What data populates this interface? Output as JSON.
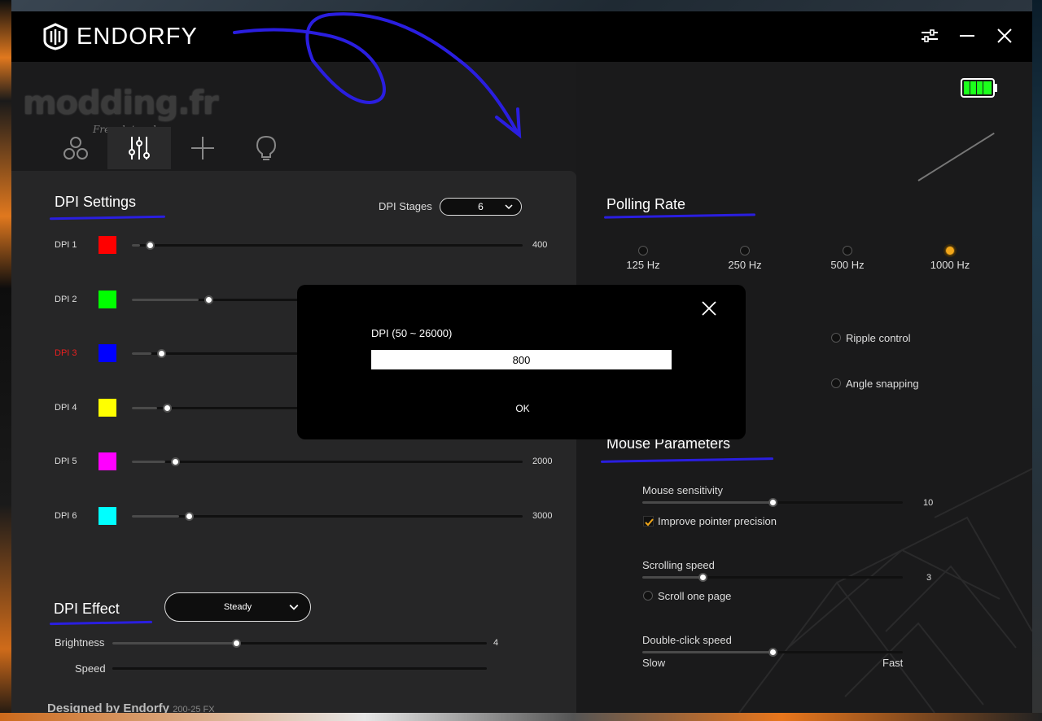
{
  "app": {
    "brand": "ENDORFY"
  },
  "watermark": {
    "text": "modding.fr",
    "subtitle": "French touch"
  },
  "tabs": [
    {
      "name": "profiles",
      "icon": "profiles-icon"
    },
    {
      "name": "settings",
      "icon": "sliders-icon",
      "active": true
    },
    {
      "name": "macros",
      "icon": "plus-icon"
    },
    {
      "name": "lighting",
      "icon": "lightbulb-icon"
    }
  ],
  "dpi_settings": {
    "title": "DPI Settings",
    "stages_label": "DPI Stages",
    "stages_value": "6",
    "active_stage": 3,
    "rows": [
      {
        "label": "DPI 1",
        "color": "#ff0000",
        "value": "400",
        "fraction": 0.02
      },
      {
        "label": "DPI 2",
        "color": "#00ff00",
        "value": "",
        "fraction": 0.17
      },
      {
        "label": "DPI 3",
        "color": "#0000ff",
        "value": "",
        "fraction": 0.05
      },
      {
        "label": "DPI 4",
        "color": "#ffff00",
        "value": "",
        "fraction": 0.065
      },
      {
        "label": "DPI 5",
        "color": "#ff00ff",
        "value": "2000",
        "fraction": 0.085
      },
      {
        "label": "DPI 6",
        "color": "#00ffff",
        "value": "3000",
        "fraction": 0.12
      }
    ]
  },
  "dpi_effect": {
    "title": "DPI Effect",
    "mode": "Steady",
    "brightness_label": "Brightness",
    "brightness_value": "4",
    "brightness_fraction": 0.33,
    "speed_label": "Speed",
    "speed_fraction": 0
  },
  "polling_rate": {
    "title": "Polling Rate",
    "options": [
      {
        "label": "125 Hz",
        "selected": false
      },
      {
        "label": "250 Hz",
        "selected": false
      },
      {
        "label": "500 Hz",
        "selected": false
      },
      {
        "label": "1000 Hz",
        "selected": true
      }
    ]
  },
  "toggles": {
    "ripple_control": "Ripple control",
    "angle_snapping": "Angle snapping"
  },
  "mouse_parameters": {
    "title": "Mouse Parameters",
    "sensitivity_label": "Mouse sensitivity",
    "sensitivity_value": "10",
    "sensitivity_fraction": 0.5,
    "pointer_precision_label": "Improve pointer precision",
    "pointer_precision_checked": true,
    "scrolling_label": "Scrolling speed",
    "scrolling_value": "3",
    "scrolling_fraction": 0.23,
    "scroll_one_page_label": "Scroll one page",
    "double_click_label": "Double-click speed",
    "double_click_fraction": 0.5,
    "slow_label": "Slow",
    "fast_label": "Fast"
  },
  "modal": {
    "label": "DPI   (50 ~ 26000)",
    "value": "800",
    "ok_label": "OK"
  },
  "footer": {
    "text": "Designed by Endorfy",
    "version": "200-25 FX"
  },
  "colors": {
    "accent": "#f2a71a",
    "active_dpi_label": "#e82020",
    "pen": "#2a1ee0",
    "battery": "#1cff1c"
  }
}
